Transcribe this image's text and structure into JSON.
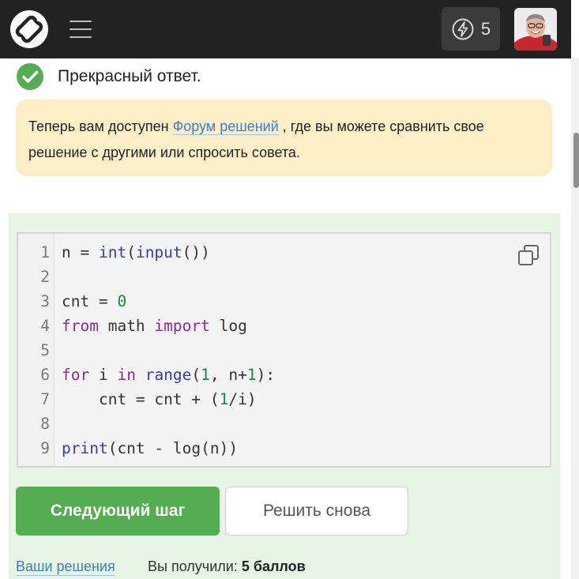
{
  "header": {
    "energy_count": "5"
  },
  "result": {
    "message": "Прекрасный ответ."
  },
  "notice": {
    "before": "Теперь вам доступен ",
    "link": "Форум решений",
    "after": " , где вы можете сравнить свое решение с другими или спросить совета."
  },
  "code": {
    "lines": [
      "n = int(input())",
      "",
      "cnt = 0",
      "from math import log",
      "",
      "for i in range(1, n+1):",
      "    cnt = cnt + (1/i)",
      "",
      "print(cnt - log(n))"
    ],
    "line_numbers": [
      "1",
      "2",
      "3",
      "4",
      "5",
      "6",
      "7",
      "8",
      "9"
    ]
  },
  "actions": {
    "next_label": "Следующий шаг",
    "retry_label": "Решить снова"
  },
  "footer": {
    "solutions_link": "Ваши решения",
    "score_label": "Вы получили:",
    "score_value": "5 баллов"
  },
  "colors": {
    "header_bg": "#222222",
    "success_green": "#54ad52",
    "notice_bg": "#fcefc7",
    "panel_bg": "#e6f5e4",
    "link": "#3b7fc4"
  }
}
